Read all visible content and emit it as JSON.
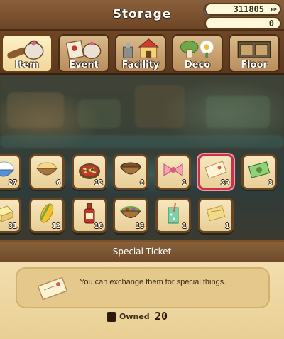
{
  "header": {
    "title": "Storage",
    "np_value": "311805",
    "np_unit": "NP",
    "gem_value": "0"
  },
  "tabs": [
    {
      "label": "Item",
      "icon": "sack-icon",
      "active": true
    },
    {
      "label": "Event",
      "icon": "scroll-icon",
      "active": false
    },
    {
      "label": "Facility",
      "icon": "house-icon",
      "active": false
    },
    {
      "label": "Deco",
      "icon": "mushroom-icon",
      "active": false
    },
    {
      "label": "Floor",
      "icon": "floor-icon",
      "active": false
    }
  ],
  "items_row1": [
    {
      "name": "bowl-rice",
      "count": "27"
    },
    {
      "name": "sand-bowl",
      "count": "6"
    },
    {
      "name": "pizza",
      "count": "12"
    },
    {
      "name": "empty-bowl",
      "count": "6"
    },
    {
      "name": "ribbon",
      "count": "1"
    },
    {
      "name": "special-ticket",
      "count": "20",
      "selected": true
    },
    {
      "name": "banknote",
      "count": "3"
    }
  ],
  "items_row2": [
    {
      "name": "butter",
      "count": "31"
    },
    {
      "name": "corn",
      "count": "12"
    },
    {
      "name": "sauce-bottle",
      "count": "10"
    },
    {
      "name": "salad-bowl",
      "count": "13"
    },
    {
      "name": "soda-glass",
      "count": "1"
    },
    {
      "name": "ticket",
      "count": "1"
    }
  ],
  "detail": {
    "title": "Special Ticket",
    "description": "You can exchange them for special things.",
    "owned_label": "Owned",
    "owned_count": "20"
  },
  "colors": {
    "panel_brown": "#6e4626",
    "slot_fill": "#f7e6bf",
    "selected_border": "#c8324a"
  }
}
